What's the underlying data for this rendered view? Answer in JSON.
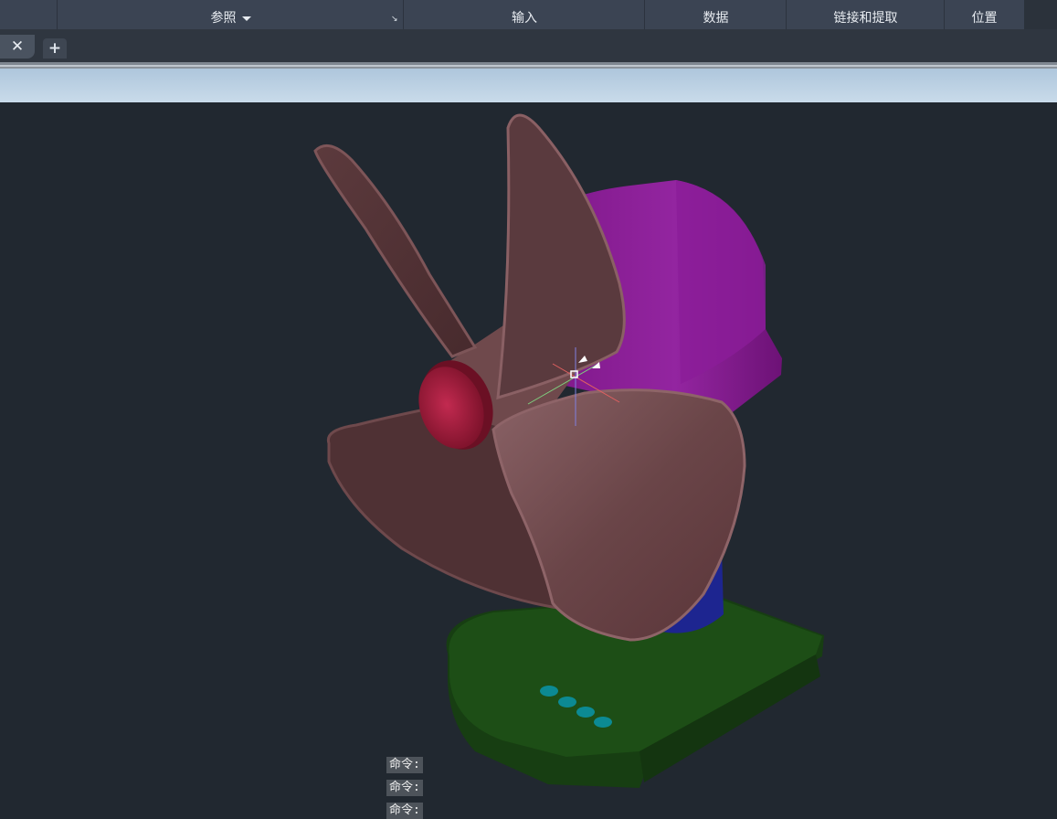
{
  "ribbon": {
    "panels": [
      {
        "label": "参照"
      },
      {
        "label": "输入"
      },
      {
        "label": "数据"
      },
      {
        "label": "链接和提取"
      },
      {
        "label": "位置"
      }
    ],
    "launcher_icon": "dialog-launcher-icon"
  },
  "tabs": {
    "close_icon": "close-icon",
    "add_icon": "plus-icon"
  },
  "command_history": [
    "命令:",
    "命令:",
    "命令:"
  ],
  "colors": {
    "background": "#212830",
    "blade": "#6a4548",
    "motor": "#8a1c97",
    "base": "#1d4e16",
    "hub_cap": "#a81d3d",
    "stem": "#1d2590",
    "buttons": "#0c8a93"
  }
}
